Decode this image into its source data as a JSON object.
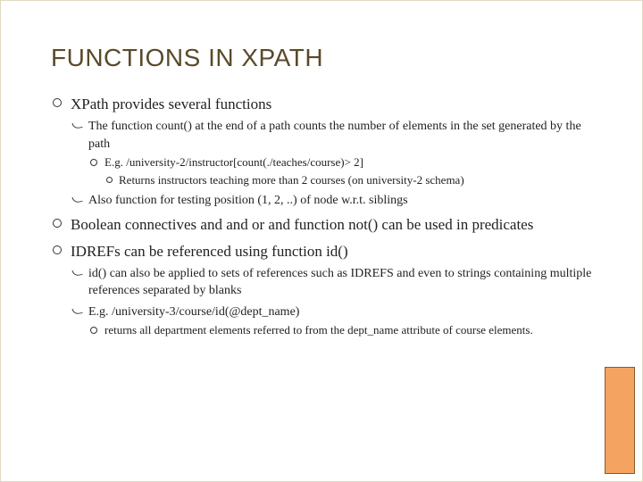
{
  "title": "FUNCTIONS IN XPATH",
  "b1": {
    "text": "XPath provides several functions",
    "s1": {
      "text_a": "The function ",
      "text_b": "count()",
      "text_c": " at the end of a path counts the number of elements in the set generated by the path",
      "e1": {
        "label": "E.g. ",
        "code": "/university-2/instructor[count(./teaches/course)> 2]",
        "note": "Returns instructors teaching more than 2 courses (on university-2 schema)"
      }
    },
    "s2": "Also function for testing position (1, 2, ..) of node w.r.t. siblings"
  },
  "b2": {
    "text_a": "Boolean connectives ",
    "text_b": "and",
    "text_c": " and ",
    "text_d": "or",
    "text_e": " and function ",
    "text_f": "not()",
    "text_g": " can be used in predicates"
  },
  "b3": {
    "text_a": "IDREFs can be referenced using function ",
    "text_b": "id()",
    "s1": {
      "text_a": "id()",
      "text_b": " can also be applied to sets of references such as IDREFS and even to strings containing multiple references separated by blanks"
    },
    "s2": {
      "label": "E.g. ",
      "code": "/university-3/course/id(@dept_name)",
      "note": "returns all department elements referred to from the dept_name attribute of course elements."
    }
  }
}
